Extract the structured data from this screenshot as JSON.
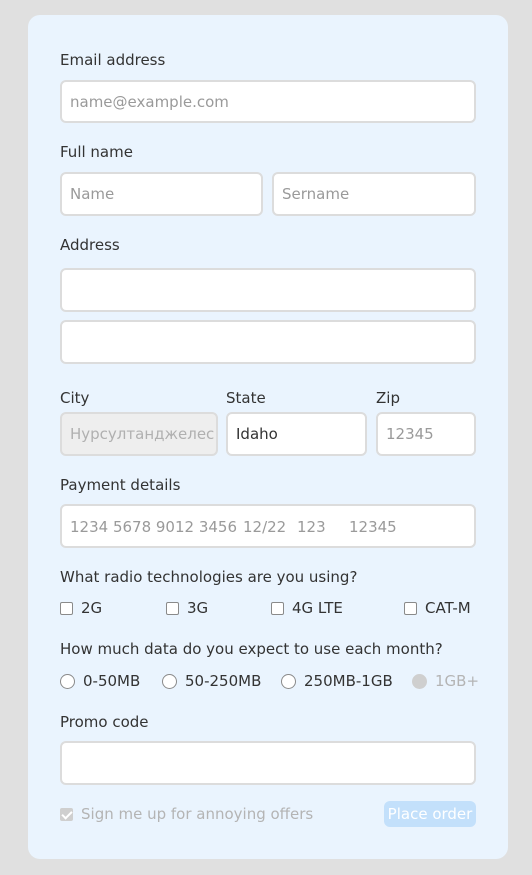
{
  "form": {
    "email": {
      "label": "Email address",
      "placeholder": "name@example.com"
    },
    "full_name": {
      "label": "Full name",
      "first_placeholder": "Name",
      "last_placeholder": "Sername"
    },
    "address": {
      "label": "Address"
    },
    "city": {
      "label": "City",
      "placeholder": "Нурсултанджелес",
      "disabled": true
    },
    "state": {
      "label": "State",
      "value": "Idaho"
    },
    "zip": {
      "label": "Zip",
      "placeholder": "12345"
    },
    "payment": {
      "label": "Payment details",
      "card_number": "1234 5678 9012 3456",
      "expiry": "12/22",
      "cvc": "123",
      "zip": "12345"
    },
    "radio_tech": {
      "question": "What radio technologies are you using?",
      "options": [
        "2G",
        "3G",
        "4G LTE",
        "CAT-M"
      ]
    },
    "data_usage": {
      "question": "How much data do you expect to use each month?",
      "options": [
        "0-50MB",
        "50-250MB",
        "250MB-1GB",
        "1GB+"
      ],
      "selected": "1GB+"
    },
    "promo": {
      "label": "Promo code"
    },
    "offers": {
      "label": "Sign me up for annoying offers",
      "checked": true,
      "disabled": true
    },
    "submit": {
      "label": "Place order",
      "disabled": true
    }
  },
  "colors": {
    "page_bg": "#e0e0e0",
    "card_bg": "#eaf4fe",
    "border": "#dcdcdc",
    "button_bg": "#c3e0fb"
  }
}
